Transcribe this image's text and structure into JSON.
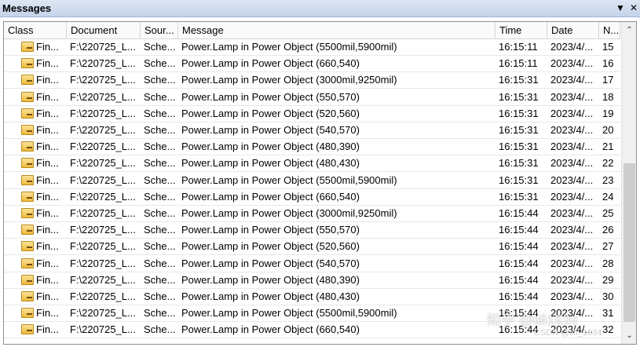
{
  "panel": {
    "title": "Messages",
    "pin_icon": "▼",
    "close_icon": "✕"
  },
  "columns": [
    {
      "key": "class",
      "label": "Class"
    },
    {
      "key": "document",
      "label": "Document"
    },
    {
      "key": "source",
      "label": "Sour..."
    },
    {
      "key": "message",
      "label": "Message"
    },
    {
      "key": "time",
      "label": "Time"
    },
    {
      "key": "date",
      "label": "Date"
    },
    {
      "key": "no",
      "label": "N..."
    }
  ],
  "rows": [
    {
      "class": "Fin...",
      "document": "F:\\220725_L...",
      "source": "Sche...",
      "message": "Power.Lamp in Power Object (5500mil,5900mil)",
      "time": "16:15:11",
      "date": "2023/4/...",
      "no": "15"
    },
    {
      "class": "Fin...",
      "document": "F:\\220725_L...",
      "source": "Sche...",
      "message": "Power.Lamp in Power Object (660,540)",
      "time": "16:15:11",
      "date": "2023/4/...",
      "no": "16"
    },
    {
      "class": "Fin...",
      "document": "F:\\220725_L...",
      "source": "Sche...",
      "message": "Power.Lamp in Power Object (3000mil,9250mil)",
      "time": "16:15:31",
      "date": "2023/4/...",
      "no": "17"
    },
    {
      "class": "Fin...",
      "document": "F:\\220725_L...",
      "source": "Sche...",
      "message": "Power.Lamp in Power Object (550,570)",
      "time": "16:15:31",
      "date": "2023/4/...",
      "no": "18"
    },
    {
      "class": "Fin...",
      "document": "F:\\220725_L...",
      "source": "Sche...",
      "message": "Power.Lamp in Power Object (520,560)",
      "time": "16:15:31",
      "date": "2023/4/...",
      "no": "19"
    },
    {
      "class": "Fin...",
      "document": "F:\\220725_L...",
      "source": "Sche...",
      "message": "Power.Lamp in Power Object (540,570)",
      "time": "16:15:31",
      "date": "2023/4/...",
      "no": "20"
    },
    {
      "class": "Fin...",
      "document": "F:\\220725_L...",
      "source": "Sche...",
      "message": "Power.Lamp in Power Object (480,390)",
      "time": "16:15:31",
      "date": "2023/4/...",
      "no": "21"
    },
    {
      "class": "Fin...",
      "document": "F:\\220725_L...",
      "source": "Sche...",
      "message": "Power.Lamp in Power Object (480,430)",
      "time": "16:15:31",
      "date": "2023/4/...",
      "no": "22"
    },
    {
      "class": "Fin...",
      "document": "F:\\220725_L...",
      "source": "Sche...",
      "message": "Power.Lamp in Power Object (5500mil,5900mil)",
      "time": "16:15:31",
      "date": "2023/4/...",
      "no": "23"
    },
    {
      "class": "Fin...",
      "document": "F:\\220725_L...",
      "source": "Sche...",
      "message": "Power.Lamp in Power Object (660,540)",
      "time": "16:15:31",
      "date": "2023/4/...",
      "no": "24"
    },
    {
      "class": "Fin...",
      "document": "F:\\220725_L...",
      "source": "Sche...",
      "message": "Power.Lamp in Power Object (3000mil,9250mil)",
      "time": "16:15:44",
      "date": "2023/4/...",
      "no": "25"
    },
    {
      "class": "Fin...",
      "document": "F:\\220725_L...",
      "source": "Sche...",
      "message": "Power.Lamp in Power Object (550,570)",
      "time": "16:15:44",
      "date": "2023/4/...",
      "no": "26"
    },
    {
      "class": "Fin...",
      "document": "F:\\220725_L...",
      "source": "Sche...",
      "message": "Power.Lamp in Power Object (520,560)",
      "time": "16:15:44",
      "date": "2023/4/...",
      "no": "27"
    },
    {
      "class": "Fin...",
      "document": "F:\\220725_L...",
      "source": "Sche...",
      "message": "Power.Lamp in Power Object (540,570)",
      "time": "16:15:44",
      "date": "2023/4/...",
      "no": "28"
    },
    {
      "class": "Fin...",
      "document": "F:\\220725_L...",
      "source": "Sche...",
      "message": "Power.Lamp in Power Object (480,390)",
      "time": "16:15:44",
      "date": "2023/4/...",
      "no": "29"
    },
    {
      "class": "Fin...",
      "document": "F:\\220725_L...",
      "source": "Sche...",
      "message": "Power.Lamp in Power Object (480,430)",
      "time": "16:15:44",
      "date": "2023/4/...",
      "no": "30"
    },
    {
      "class": "Fin...",
      "document": "F:\\220725_L...",
      "source": "Sche...",
      "message": "Power.Lamp in Power Object (5500mil,5900mil)",
      "time": "16:15:44",
      "date": "2023/4/...",
      "no": "31"
    },
    {
      "class": "Fin...",
      "document": "F:\\220725_L...",
      "source": "Sche...",
      "message": "Power.Lamp in Power Object (660,540)",
      "time": "16:15:44",
      "date": "2023/4/...",
      "no": "32"
    }
  ],
  "scrollbar": {
    "up_icon": "⌃",
    "down_icon": "⌄"
  },
  "watermark": {
    "main": "知乎 @lifi1634",
    "sub": "CSDN @lifi_1634"
  },
  "colors": {
    "title_bar": "#c4d3ea",
    "row_icon": "#f0b93a"
  }
}
